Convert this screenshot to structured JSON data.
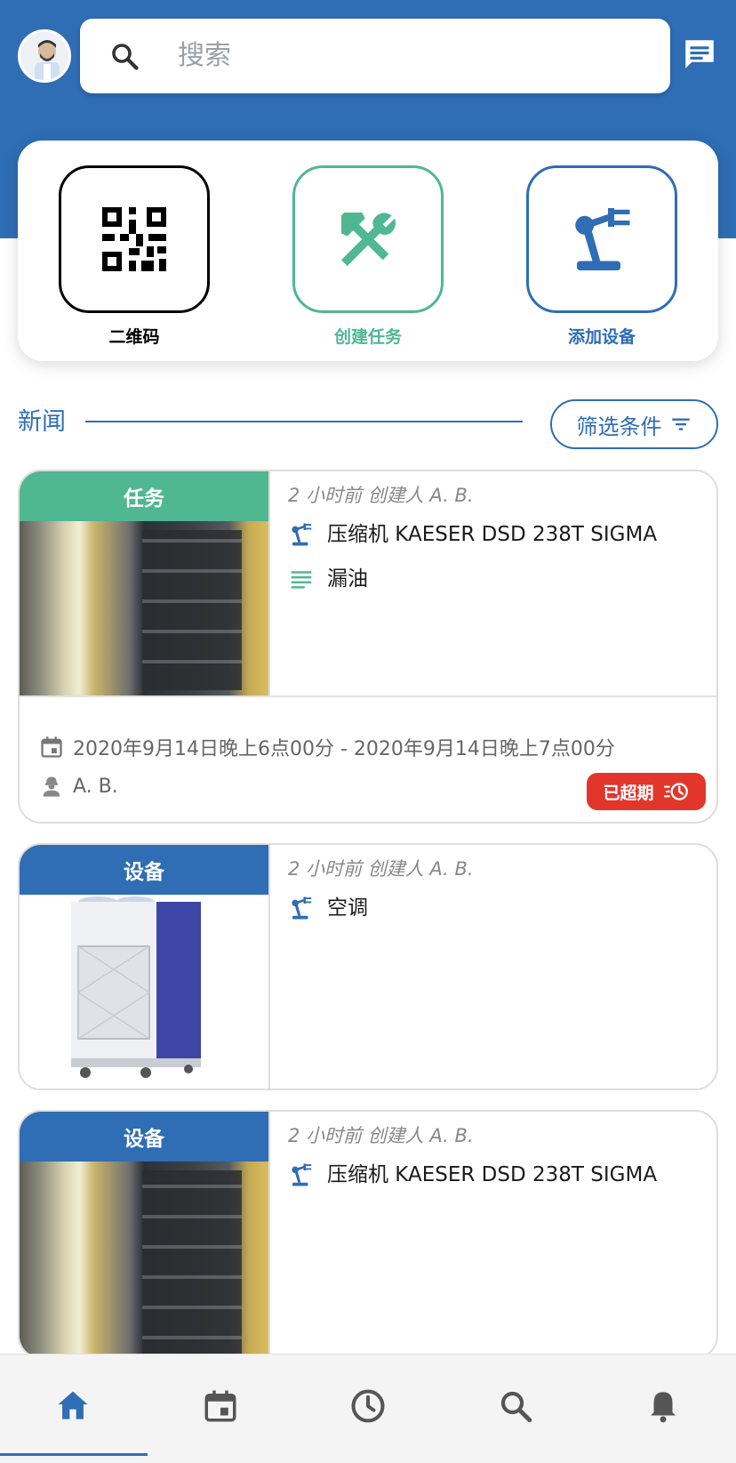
{
  "colors": {
    "brand_blue": "#2f6db5",
    "task_green": "#4fb792",
    "overdue_red": "#e2362c"
  },
  "header": {
    "search_placeholder": "搜索",
    "avatar_icon": "user-avatar",
    "chat_icon": "chat-icon"
  },
  "actions": [
    {
      "label": "二维码",
      "icon": "qr-code-icon",
      "color": "#000000"
    },
    {
      "label": "创建任务",
      "icon": "tools-icon",
      "color": "#4fb792"
    },
    {
      "label": "添加设备",
      "icon": "robot-arm-icon",
      "color": "#2f6db5"
    }
  ],
  "news": {
    "title": "新闻",
    "filter_label": "筛选条件"
  },
  "feed": [
    {
      "badge": "任务",
      "badge_color": "#4fb792",
      "meta": "2 小时前 创建人 A. B.",
      "equipment": "压缩机 KAESER DSD 238T SIGMA",
      "description": "漏油",
      "schedule": "2020年9月14日晚上6点00分 - 2020年9月14日晚上7点00分",
      "assignee": "A. B.",
      "status": "已超期"
    },
    {
      "badge": "设备",
      "badge_color": "#2f6db5",
      "meta": "2 小时前 创建人 A. B.",
      "equipment": "空调"
    },
    {
      "badge": "设备",
      "badge_color": "#2f6db5",
      "meta": "2 小时前 创建人 A. B.",
      "equipment": "压缩机 KAESER DSD 238T SIGMA"
    }
  ],
  "bottom_nav": [
    {
      "icon": "home-icon",
      "active": true
    },
    {
      "icon": "calendar-icon",
      "active": false
    },
    {
      "icon": "clock-icon",
      "active": false
    },
    {
      "icon": "search-icon",
      "active": false
    },
    {
      "icon": "bell-icon",
      "active": false
    }
  ]
}
